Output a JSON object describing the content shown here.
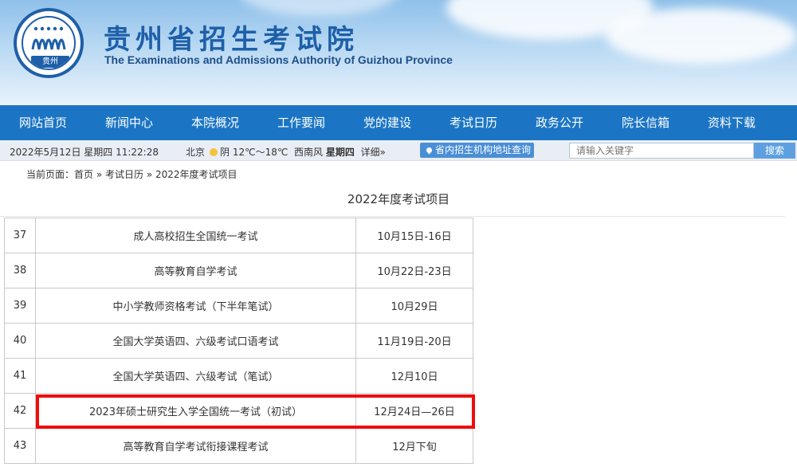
{
  "header": {
    "logo_label": "贵州",
    "title": "贵州省招生考试院",
    "subtitle": "The Examinations and Admissions Authority of Guizhou Province"
  },
  "nav": {
    "items": [
      "网站首页",
      "新闻中心",
      "本院概况",
      "工作要闻",
      "党的建设",
      "考试日历",
      "政务公开",
      "院长信箱",
      "资料下载"
    ]
  },
  "infobar": {
    "date": "2022年5月12日 星期四 11:22:28",
    "city": "北京",
    "weather": "阴 12℃～18℃",
    "wind": "西南风",
    "weekday": "星期四",
    "detail": "详细»",
    "org_lookup": "省内招生机构地址查询",
    "search_placeholder": "请输入关键字",
    "search_button": "搜索"
  },
  "breadcrumb": {
    "prefix": "当前页面：",
    "home": "首页",
    "sep1": " » ",
    "calendar": "考试日历",
    "sep2": " » ",
    "current": "2022年度考试项目"
  },
  "page_title": "2022年度考试项目",
  "table": {
    "rows": [
      {
        "no": "37",
        "name": "成人高校招生全国统一考试",
        "date": "10月15日-16日"
      },
      {
        "no": "38",
        "name": "高等教育自学考试",
        "date": "10月22日-23日"
      },
      {
        "no": "39",
        "name": "中小学教师资格考试（下半年笔试）",
        "date": "10月29日"
      },
      {
        "no": "40",
        "name": "全国大学英语四、六级考试口语考试",
        "date": "11月19日-20日"
      },
      {
        "no": "41",
        "name": "全国大学英语四、六级考试（笔试）",
        "date": "12月10日"
      },
      {
        "no": "42",
        "name": "2023年硕士研究生入学全国统一考试（初试）",
        "date": "12月24日—26日"
      },
      {
        "no": "43",
        "name": "高等教育自学考试衔接课程考试",
        "date": "12月下旬"
      }
    ]
  },
  "colors": {
    "nav_bg": "#1b75c4",
    "brand_blue": "#1e5fa8",
    "highlight_red": "#ee0d0d"
  },
  "icons": [
    "university-logo-icon",
    "sun-weather-icon",
    "location-pin-icon"
  ]
}
